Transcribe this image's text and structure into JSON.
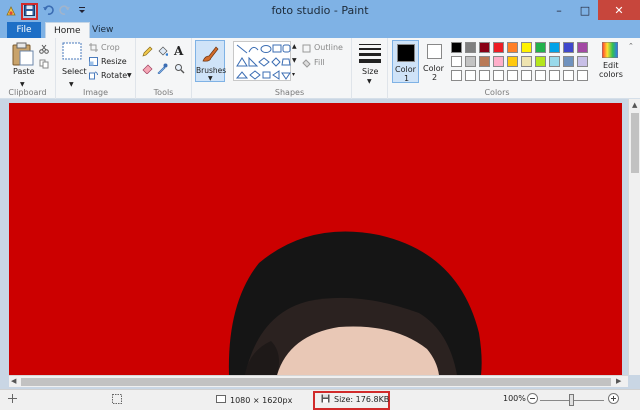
{
  "window": {
    "title": "foto studio - Paint",
    "controls": {
      "minimize": "–",
      "maximize": "□",
      "close": "✕"
    }
  },
  "qat": {
    "icons": [
      "paint-app-icon",
      "save-icon",
      "undo-icon",
      "redo-icon",
      "customize-icon"
    ]
  },
  "tabs": [
    {
      "label": "File",
      "active": false
    },
    {
      "label": "Home",
      "active": true
    },
    {
      "label": "View",
      "active": false
    }
  ],
  "ribbon": {
    "clipboard": {
      "label": "Clipboard",
      "paste": "Paste"
    },
    "image": {
      "label": "Image",
      "select": "Select",
      "crop": "Crop",
      "resize": "Resize",
      "rotate": "Rotate"
    },
    "tools": {
      "label": "Tools"
    },
    "brushes": {
      "label": "Brushes"
    },
    "shapes": {
      "label": "Shapes",
      "outline": "Outline",
      "fill": "Fill"
    },
    "size": {
      "label": "Size"
    },
    "color1": {
      "label": "Color",
      "num": "1",
      "color": "#000000"
    },
    "color2": {
      "label": "Color",
      "num": "2",
      "color": "#ffffff"
    },
    "colors": {
      "label": "Colors",
      "edit_label": "Edit",
      "edit_label2": "colors",
      "palette_row1": [
        "#000000",
        "#7f7f7f",
        "#880015",
        "#ed1c24",
        "#ff7f27",
        "#fff200",
        "#22b14c",
        "#00a2e8",
        "#3f48cc",
        "#a349a4"
      ],
      "palette_row2": [
        "#ffffff",
        "#c3c3c3",
        "#b97a57",
        "#ffaec9",
        "#ffc90e",
        "#efe4b0",
        "#b5e61d",
        "#99d9ea",
        "#7092be",
        "#c8bfe7"
      ],
      "palette_row3": [
        "#ffffff",
        "#ffffff",
        "#ffffff",
        "#ffffff",
        "#ffffff",
        "#ffffff",
        "#ffffff",
        "#ffffff",
        "#ffffff",
        "#ffffff"
      ]
    }
  },
  "canvas": {
    "background": "#cc0000"
  },
  "status": {
    "dimensions": "1080 × 1620px",
    "size": "Size: 176.8KB",
    "zoom": "100%"
  }
}
